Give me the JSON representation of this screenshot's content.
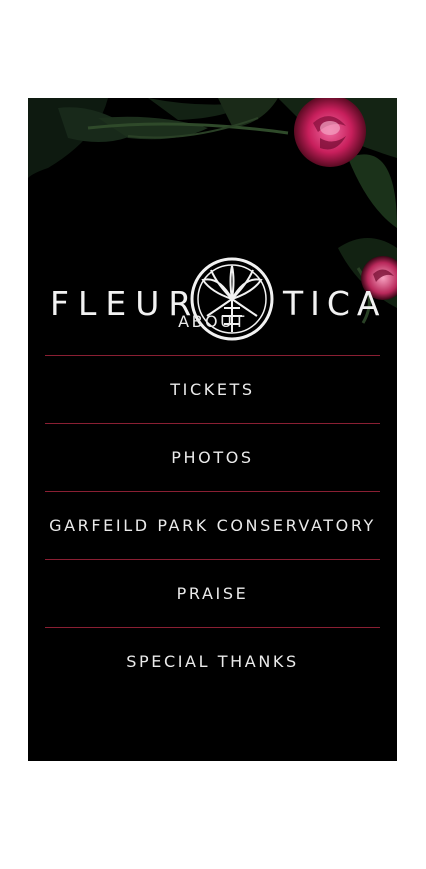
{
  "brand": {
    "left": "FLEUR",
    "right": "TICA",
    "logo_icon": "ornate-circle-emblem"
  },
  "nav": {
    "items": [
      {
        "label": "ABOUT"
      },
      {
        "label": "TICKETS"
      },
      {
        "label": "PHOTOS"
      },
      {
        "label": "GARFEILD PARK CONSERVATORY"
      },
      {
        "label": "PRAISE"
      },
      {
        "label": "SPECIAL THANKS"
      }
    ]
  },
  "colors": {
    "panel": "#000000",
    "divider": "#8a1f33",
    "text": "#eaeaea",
    "rose": "#d9346f"
  }
}
